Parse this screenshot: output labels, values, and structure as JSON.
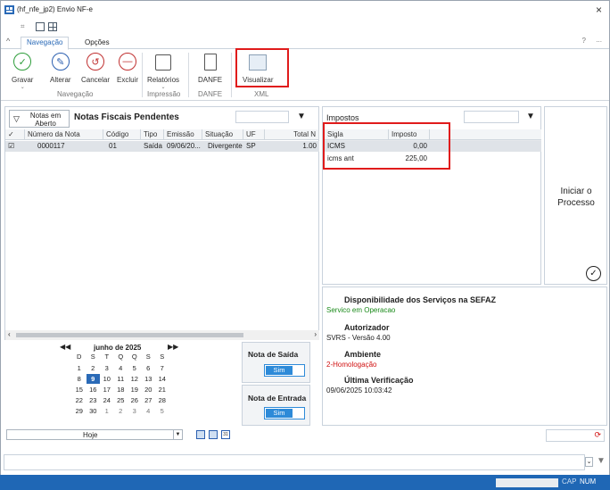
{
  "window": {
    "title": "(hf_nfe_jp2) Envio NF-e",
    "close": "×"
  },
  "tabs": [
    "Navegação",
    "Opções"
  ],
  "help": "?",
  "more": "...",
  "ribbon": {
    "buttons": [
      "Gravar",
      "Alterar",
      "Cancelar",
      "Excluir",
      "Relatórios",
      "DANFE",
      "Visualizar"
    ],
    "groups": [
      "Navegação",
      "Impressão",
      "DANFE",
      "XML"
    ]
  },
  "notas": {
    "filter_label": "Notas em Aberto",
    "title": "Notas Fiscais Pendentes",
    "columns": [
      "Número da Nota",
      "Código",
      "Tipo",
      "Emissão",
      "Situação",
      "UF",
      "Total N"
    ],
    "rows": [
      {
        "numero": "0000117",
        "codigo": "01",
        "tipo": "Saída",
        "emissao": "09/06/20...",
        "situacao": "Divergente",
        "uf": "SP",
        "total": "1.00"
      }
    ]
  },
  "impostos": {
    "title": "Impostos",
    "columns": [
      "Sigla",
      "Imposto"
    ],
    "rows": [
      {
        "sigla": "ICMS",
        "imposto": "0,00"
      },
      {
        "sigla": "icms ant",
        "imposto": "225,00"
      }
    ]
  },
  "processo": {
    "label_line1": "Iniciar o",
    "label_line2": "Processo"
  },
  "calendar": {
    "prev": "◀◀",
    "next": "▶▶",
    "month": "junho de 2025",
    "weekdays": [
      "D",
      "S",
      "T",
      "Q",
      "Q",
      "S",
      "S"
    ],
    "weeks": [
      [
        "",
        "",
        "",
        "",
        "",
        "",
        ""
      ],
      [
        "1",
        "2",
        "3",
        "4",
        "5",
        "6",
        "7"
      ],
      [
        "8",
        "9",
        "10",
        "11",
        "12",
        "13",
        "14"
      ],
      [
        "15",
        "16",
        "17",
        "18",
        "19",
        "20",
        "21"
      ],
      [
        "22",
        "23",
        "24",
        "25",
        "26",
        "27",
        "28"
      ],
      [
        "29",
        "30",
        "1",
        "2",
        "3",
        "4",
        "5"
      ]
    ],
    "selected": "9",
    "today_label": "Hoje"
  },
  "nota_saida": {
    "label": "Nota de Saída",
    "toggle": "Sim"
  },
  "nota_entrada": {
    "label": "Nota de Entrada",
    "toggle": "Sim"
  },
  "sefaz": {
    "disp_title": "Disponibilidade dos Serviços na SEFAZ",
    "disp_value": "Servico em Operacao",
    "aut_title": "Autorizador",
    "aut_value": "SVRS - Versão 4.00",
    "amb_title": "Ambiente",
    "amb_value": "2-Homologação",
    "ult_title": "Última Verificação",
    "ult_value": "09/06/2025 10:03:42"
  },
  "status": {
    "cap": "CAP",
    "num": "NUM"
  },
  "colors": {
    "accent": "#2d8ad8",
    "highlight": "#e01b1b",
    "green": "#1a8a1a",
    "red": "#d01010"
  }
}
